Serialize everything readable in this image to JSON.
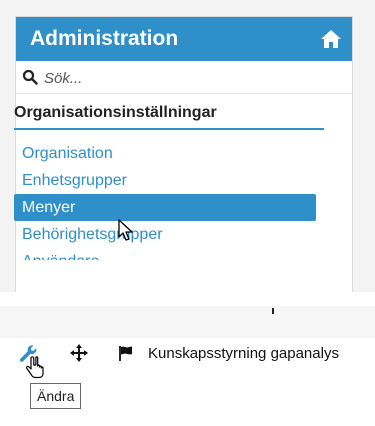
{
  "panel": {
    "title": "Administration",
    "home_icon": "home-icon",
    "search": {
      "placeholder": "Sök...",
      "icon": "search-icon"
    },
    "section_title": "Organisationsinställningar",
    "items": [
      {
        "label": "Organisation",
        "active": false
      },
      {
        "label": "Enhetsgrupper",
        "active": false
      },
      {
        "label": "Menyer",
        "active": true
      },
      {
        "label": "Behörighetsgrupper",
        "active": false
      },
      {
        "label": "Användare",
        "active": false
      }
    ]
  },
  "toolbar": {
    "edit_icon": "wrench-icon",
    "move_icon": "move-icon",
    "flag_icon": "flag-icon",
    "row_label": "Kunskapsstyrning gapanalys",
    "tooltip": "Ändra"
  },
  "colors": {
    "accent": "#2e8fc9",
    "panel_border": "#d9d9d9"
  }
}
